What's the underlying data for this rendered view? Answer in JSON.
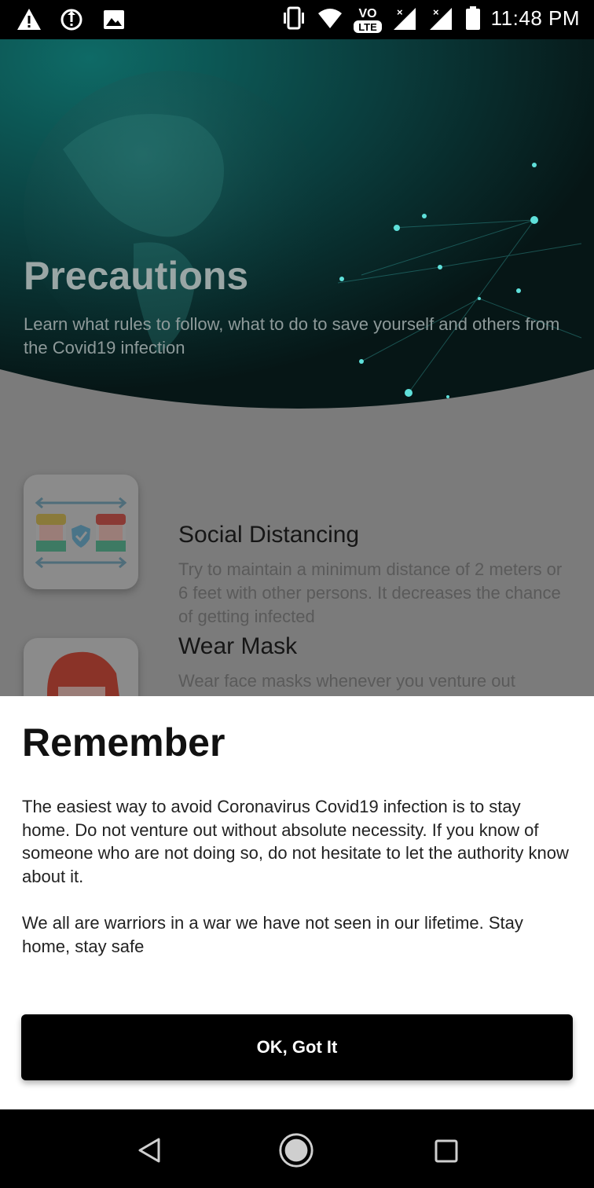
{
  "status_bar": {
    "time": "11:48 PM",
    "lte_label": "LTE",
    "vo_label": "VO",
    "left_icons": [
      "warning-icon",
      "sync-icon",
      "image-icon"
    ],
    "right_icons": [
      "vibrate-icon",
      "wifi-icon",
      "volte-icon",
      "signal-icon",
      "signal-icon",
      "battery-icon"
    ]
  },
  "hero": {
    "title": "Precautions",
    "subtitle": "Learn what rules to follow, what to do to save yourself and others from the Covid19 infection"
  },
  "items": [
    {
      "title": "Social Distancing",
      "description": "Try to maintain a minimum distance of 2 meters or 6 feet with other persons. It decreases the chance of getting infected",
      "icon": "social-distancing-icon"
    },
    {
      "title": "Wear Mask",
      "description": "Wear face masks whenever you venture out",
      "icon": "mask-person-icon"
    }
  ],
  "dialog": {
    "title": "Remember",
    "paragraph1": "The easiest way to avoid Coronavirus Covid19 infection is to stay home. Do not venture out without absolute necessity. If you know of someone who are not doing so, do not hesitate to let the authority know about it.",
    "paragraph2": "We all are warriors in a war we have not seen in our lifetime. Stay home, stay safe",
    "button_label": "OK, Got It"
  },
  "nav_bar": {
    "icons": [
      "back-icon",
      "home-icon",
      "recents-icon"
    ]
  },
  "colors": {
    "scrim_gray": "#7b7b7b",
    "hero_teal": "#0b3a3a",
    "button_bg": "#000000",
    "sheet_bg": "#ffffff"
  }
}
